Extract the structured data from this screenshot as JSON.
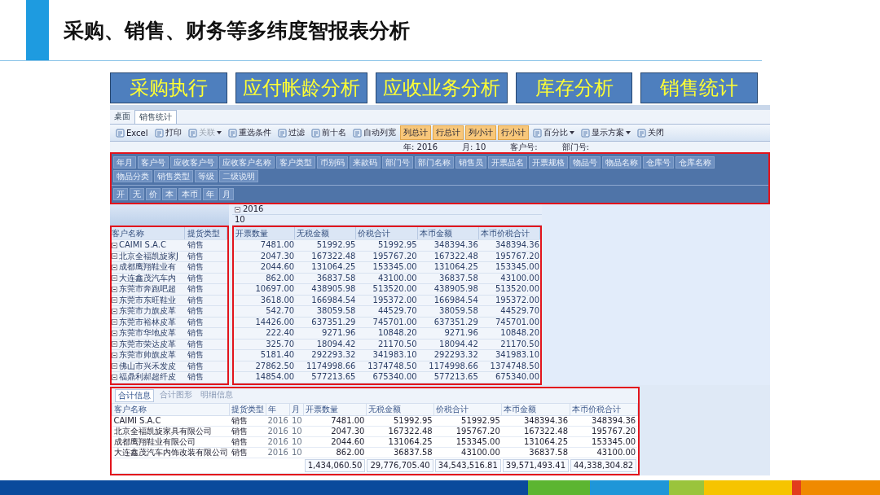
{
  "slide": {
    "title": "采购、销售、财务等多纬度智报表分析",
    "modules": [
      {
        "label": "采购执行"
      },
      {
        "label": "应付帐龄分析"
      },
      {
        "label": "应收业务分析"
      },
      {
        "label": "库存分析"
      },
      {
        "label": "销售统计"
      }
    ]
  },
  "app": {
    "tabs": [
      {
        "label": "桌面",
        "selected": false
      },
      {
        "label": "销售统计",
        "selected": true
      }
    ],
    "toolbar": [
      {
        "kind": "button",
        "label": "Excel",
        "disabled": false,
        "on": false
      },
      {
        "kind": "button",
        "label": "打印",
        "disabled": false,
        "on": false
      },
      {
        "kind": "menu",
        "label": "关联",
        "disabled": true,
        "on": false
      },
      {
        "kind": "button",
        "label": "重选条件",
        "disabled": false,
        "on": false
      },
      {
        "kind": "button",
        "label": "过滤",
        "disabled": false,
        "on": false
      },
      {
        "kind": "button",
        "label": "前十名",
        "disabled": false,
        "on": false
      },
      {
        "kind": "button",
        "label": "自动列宽",
        "disabled": false,
        "on": false
      },
      {
        "kind": "toggle",
        "label": "列总计",
        "disabled": false,
        "on": true
      },
      {
        "kind": "toggle",
        "label": "行总计",
        "disabled": false,
        "on": true
      },
      {
        "kind": "toggle",
        "label": "列小计",
        "disabled": false,
        "on": true
      },
      {
        "kind": "toggle",
        "label": "行小计",
        "disabled": false,
        "on": true
      },
      {
        "kind": "menu",
        "label": "百分比",
        "disabled": false,
        "on": false
      },
      {
        "kind": "menu",
        "label": "显示方案",
        "disabled": false,
        "on": false
      },
      {
        "kind": "button",
        "label": "关闭",
        "disabled": false,
        "on": false
      }
    ],
    "filters": [
      "年: 2016",
      "月: 10",
      "客户号:",
      "部门号:"
    ],
    "field_rows": [
      [
        "年月",
        "客户号",
        "应收客户号",
        "应收客户名称",
        "客户类型",
        "币别码",
        "来款码",
        "部门号",
        "部门名称",
        "销售员",
        "开票品名",
        "开票规格",
        "物品号",
        "物品名称",
        "仓库号",
        "仓库名称"
      ],
      [
        "物品分类",
        "销售类型",
        "等级",
        "二级说明"
      ]
    ],
    "axis_fields": [
      "开",
      "无",
      "价",
      "本",
      "本币",
      "年",
      "月"
    ],
    "pivot": {
      "column_headers": [
        "2016",
        "10"
      ],
      "row_fields": [
        "客户名称",
        "提货类型"
      ],
      "value_fields": [
        "开票数量",
        "无税金额",
        "价税合计",
        "本币金额",
        "本币价税合计"
      ],
      "rows": [
        {
          "customer": "CAIMI S.A.C",
          "type": "销售",
          "values": [
            "7481.00",
            "51992.95",
            "51992.95",
            "348394.36",
            "348394.36"
          ]
        },
        {
          "customer": "北京全福凯旋家J",
          "type": "销售",
          "values": [
            "2047.30",
            "167322.48",
            "195767.20",
            "167322.48",
            "195767.20"
          ]
        },
        {
          "customer": "成都鹰翔鞋业有",
          "type": "销售",
          "values": [
            "2044.60",
            "131064.25",
            "153345.00",
            "131064.25",
            "153345.00"
          ]
        },
        {
          "customer": "大连鑫茂汽车内",
          "type": "销售",
          "values": [
            "862.00",
            "36837.58",
            "43100.00",
            "36837.58",
            "43100.00"
          ]
        },
        {
          "customer": "东莞市奔跑吧超",
          "type": "销售",
          "values": [
            "10697.00",
            "438905.98",
            "513520.00",
            "438905.98",
            "513520.00"
          ]
        },
        {
          "customer": "东莞市东旺鞋业",
          "type": "销售",
          "values": [
            "3618.00",
            "166984.54",
            "195372.00",
            "166984.54",
            "195372.00"
          ]
        },
        {
          "customer": "东莞市力旗皮革",
          "type": "销售",
          "values": [
            "542.70",
            "38059.58",
            "44529.70",
            "38059.58",
            "44529.70"
          ]
        },
        {
          "customer": "东莞市裕林皮革",
          "type": "销售",
          "values": [
            "14426.00",
            "637351.29",
            "745701.00",
            "637351.29",
            "745701.00"
          ]
        },
        {
          "customer": "东莞市华地皮革",
          "type": "销售",
          "values": [
            "222.40",
            "9271.96",
            "10848.20",
            "9271.96",
            "10848.20"
          ]
        },
        {
          "customer": "东莞市荣达皮革",
          "type": "销售",
          "values": [
            "325.70",
            "18094.42",
            "21170.50",
            "18094.42",
            "21170.50"
          ]
        },
        {
          "customer": "东莞市帅旗皮革",
          "type": "销售",
          "values": [
            "5181.40",
            "292293.32",
            "341983.10",
            "292293.32",
            "341983.10"
          ]
        },
        {
          "customer": "佛山市兴禾发皮",
          "type": "销售",
          "values": [
            "27862.50",
            "1174998.66",
            "1374748.50",
            "1174998.66",
            "1374748.50"
          ]
        },
        {
          "customer": "福鼎利郝超纤皮",
          "type": "销售",
          "values": [
            "14854.00",
            "577213.65",
            "675340.00",
            "577213.65",
            "675340.00"
          ]
        }
      ]
    }
  },
  "summary": {
    "tabs": [
      {
        "label": "合计信息",
        "selected": true
      },
      {
        "label": "合计图形",
        "selected": false
      },
      {
        "label": "明细信息",
        "selected": false
      }
    ],
    "columns": [
      "客户名称",
      "提货类型",
      "年",
      "月",
      "开票数量",
      "无税金额",
      "价税合计",
      "本币金额",
      "本币价税合计"
    ],
    "rows": [
      {
        "cells": [
          "CAIMI S.A.C",
          "销售",
          "2016",
          "10",
          "7481.00",
          "51992.95",
          "51992.95",
          "348394.36",
          "348394.36"
        ]
      },
      {
        "cells": [
          "北京全福凯旋家具有限公司",
          "销售",
          "2016",
          "10",
          "2047.30",
          "167322.48",
          "195767.20",
          "167322.48",
          "195767.20"
        ]
      },
      {
        "cells": [
          "成都鹰翔鞋业有限公司",
          "销售",
          "2016",
          "10",
          "2044.60",
          "131064.25",
          "153345.00",
          "131064.25",
          "153345.00"
        ]
      },
      {
        "cells": [
          "大连鑫茂汽车内饰改装有限公司",
          "销售",
          "2016",
          "10",
          "862.00",
          "36837.58",
          "43100.00",
          "36837.58",
          "43100.00"
        ]
      }
    ],
    "totals": [
      "1,434,060.50",
      "29,776,705.40",
      "34,543,516.81",
      "39,571,493.41",
      "44,338,304.82"
    ]
  }
}
